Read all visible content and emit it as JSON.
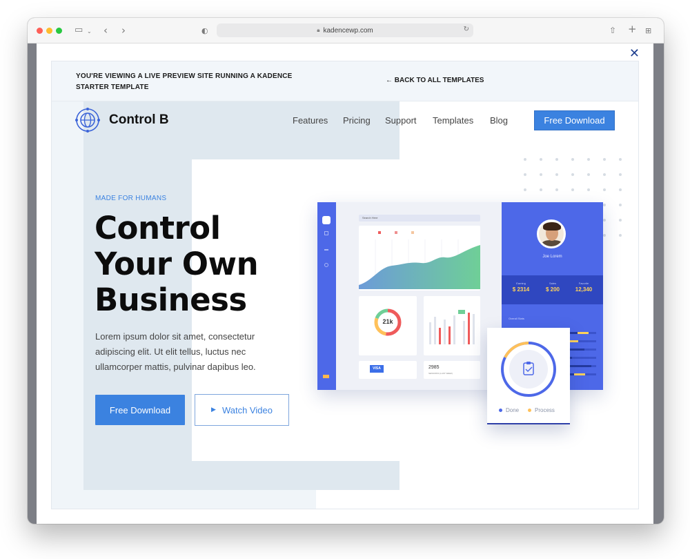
{
  "browser": {
    "url": "kadencewp.com",
    "icons": [
      "sidebar-icon",
      "chevron-down-icon",
      "back-icon",
      "forward-icon",
      "shield-icon",
      "lock-icon",
      "reload-icon",
      "share-icon",
      "new-tab-icon",
      "tab-overview-icon"
    ]
  },
  "modal": {
    "close_label": "✕"
  },
  "banner": {
    "notice": "YOU'RE VIEWING A LIVE PREVIEW SITE RUNNING A KADENCE STARTER TEMPLATE",
    "back_link": "← BACK TO ALL TEMPLATES"
  },
  "site": {
    "brand": "Control B",
    "nav": [
      "Features",
      "Pricing",
      "Support",
      "Templates",
      "Blog"
    ],
    "nav_cta": "Free Download",
    "kicker": "MADE FOR HUMANS",
    "headline": "Control Your Own Business",
    "lede": "Lorem ipsum dolor sit amet, consectetur adipiscing elit. Ut elit tellus, luctus nec ullamcorper mattis, pulvinar dapibus leo.",
    "primary_cta": "Free Download",
    "secondary_cta": "Watch Video",
    "accent_color": "#3b82e0"
  },
  "dashboard": {
    "search_placeholder": "Search Here",
    "donut_value": "21k",
    "sessions_value": "2985",
    "sessions_label": "SESSIONS (LAST WEEK)",
    "card_brand": "VISA",
    "profile_name": "Joe Lorem",
    "stats": [
      {
        "label": "Earning",
        "value": "$ 2314"
      },
      {
        "label": "Sales",
        "value": "$ 200"
      },
      {
        "label": "Favorite",
        "value": "12,340"
      }
    ],
    "overall_label": "Overall Stats",
    "done_label": "Done",
    "process_label": "Process"
  }
}
